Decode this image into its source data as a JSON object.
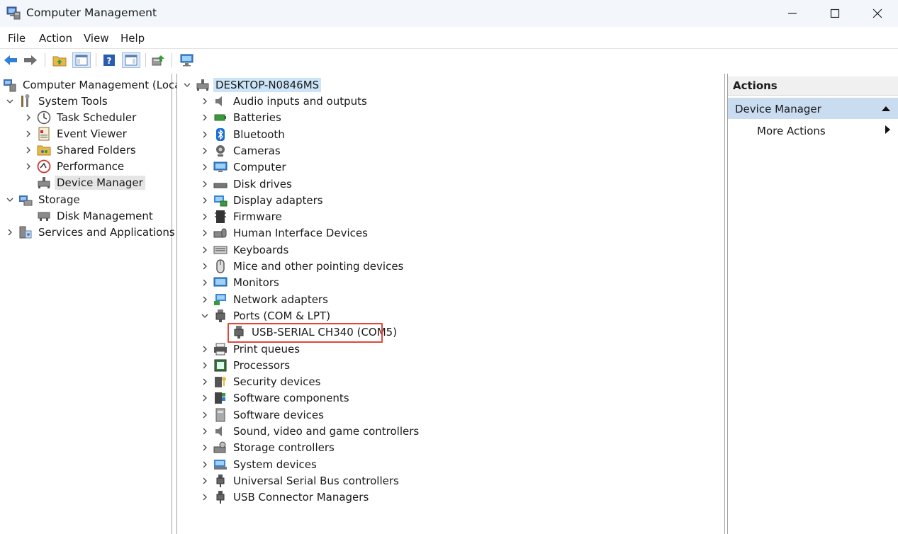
{
  "window": {
    "title": "Computer Management"
  },
  "menu": [
    "File",
    "Action",
    "View",
    "Help"
  ],
  "left_tree": {
    "root": "Computer Management (Local)",
    "system_tools": "System Tools",
    "task_scheduler": "Task Scheduler",
    "event_viewer": "Event Viewer",
    "shared_folders": "Shared Folders",
    "performance": "Performance",
    "device_manager": "Device Manager",
    "storage": "Storage",
    "disk_management": "Disk Management",
    "services": "Services and Applications"
  },
  "device_tree": {
    "root": "DESKTOP-N0846MS",
    "categories": [
      {
        "label": "Audio inputs and outputs",
        "icon": "speaker-icon"
      },
      {
        "label": "Batteries",
        "icon": "battery-icon"
      },
      {
        "label": "Bluetooth",
        "icon": "bluetooth-icon"
      },
      {
        "label": "Cameras",
        "icon": "camera-icon"
      },
      {
        "label": "Computer",
        "icon": "computer-icon"
      },
      {
        "label": "Disk drives",
        "icon": "disk-drive-icon"
      },
      {
        "label": "Display adapters",
        "icon": "display-adapter-icon"
      },
      {
        "label": "Firmware",
        "icon": "firmware-icon"
      },
      {
        "label": "Human Interface Devices",
        "icon": "hid-icon"
      },
      {
        "label": "Keyboards",
        "icon": "keyboard-icon"
      },
      {
        "label": "Mice and other pointing devices",
        "icon": "mouse-icon"
      },
      {
        "label": "Monitors",
        "icon": "monitor-icon"
      },
      {
        "label": "Network adapters",
        "icon": "network-adapter-icon"
      },
      {
        "label": "Ports (COM & LPT)",
        "icon": "port-icon"
      },
      {
        "label": "Print queues",
        "icon": "printer-icon"
      },
      {
        "label": "Processors",
        "icon": "processor-icon"
      },
      {
        "label": "Security devices",
        "icon": "security-device-icon"
      },
      {
        "label": "Software components",
        "icon": "software-component-icon"
      },
      {
        "label": "Software devices",
        "icon": "software-device-icon"
      },
      {
        "label": "Sound, video and game controllers",
        "icon": "sound-controller-icon"
      },
      {
        "label": "Storage controllers",
        "icon": "storage-controller-icon"
      },
      {
        "label": "System devices",
        "icon": "system-devices-icon"
      },
      {
        "label": "Universal Serial Bus controllers",
        "icon": "usb-icon"
      },
      {
        "label": "USB Connector Managers",
        "icon": "usb-connector-icon"
      }
    ],
    "ports_child": "USB-SERIAL CH340 (COM5)"
  },
  "actions": {
    "header": "Actions",
    "section": "Device Manager",
    "more": "More Actions"
  },
  "colors": {
    "highlight": "#e3463a",
    "selection": "#cce4f7",
    "actions_section": "#c9dcf0"
  }
}
